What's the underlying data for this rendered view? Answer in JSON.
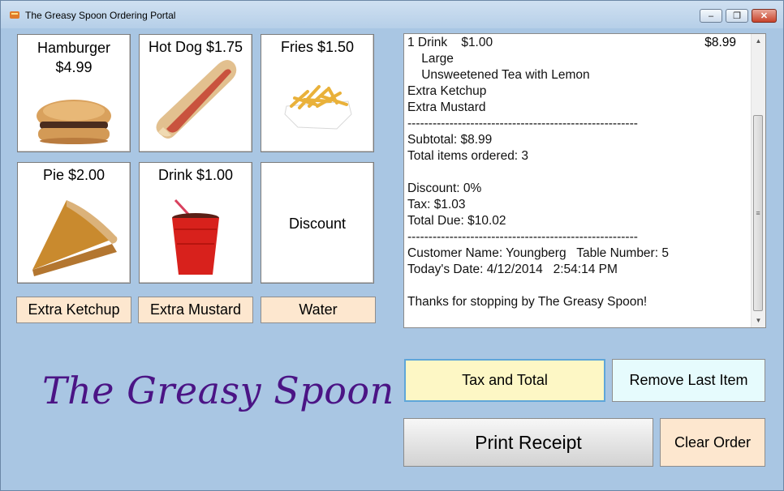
{
  "window": {
    "title": "The Greasy Spoon Ordering Portal",
    "controls": {
      "minimize": "–",
      "maximize": "❐",
      "close": "✕"
    }
  },
  "menu_items": [
    {
      "label": "Hamburger\n$4.99",
      "icon": "hamburger-icon"
    },
    {
      "label": "Hot Dog $1.75",
      "icon": "hotdog-icon"
    },
    {
      "label": "Fries $1.50",
      "icon": "fries-icon"
    },
    {
      "label": "Pie $2.00",
      "icon": "pie-icon"
    },
    {
      "label": "Drink $1.00",
      "icon": "drink-cup-icon"
    },
    {
      "label": "Discount",
      "icon": ""
    }
  ],
  "addons": [
    "Extra Ketchup",
    "Extra Mustard",
    "Water"
  ],
  "logo_text": "The Greasy Spoon",
  "receipt": {
    "price": "$8.99",
    "lines": [
      "1 Drink    $1.00",
      "    Large",
      "    Unsweetened Tea with Lemon",
      "Extra Ketchup",
      "Extra Mustard",
      "-------------------------------------------------------",
      "Subtotal: $8.99",
      "Total items ordered: 3",
      "",
      "Discount: 0%",
      "Tax: $1.03",
      "Total Due: $10.02",
      "-------------------------------------------------------",
      "Customer Name: Youngberg   Table Number: 5",
      "Today's Date: 4/12/2014   2:54:14 PM",
      "",
      "Thanks for stopping by The Greasy Spoon!"
    ]
  },
  "buttons": {
    "tax_total": "Tax and Total",
    "remove_last": "Remove Last Item",
    "print": "Print Receipt",
    "clear": "Clear Order"
  },
  "colors": {
    "addon_bg": "#fde7cf",
    "tax_bg": "#fdf7c5",
    "remove_bg": "#e6fbfd",
    "logo": "#4b1485"
  }
}
